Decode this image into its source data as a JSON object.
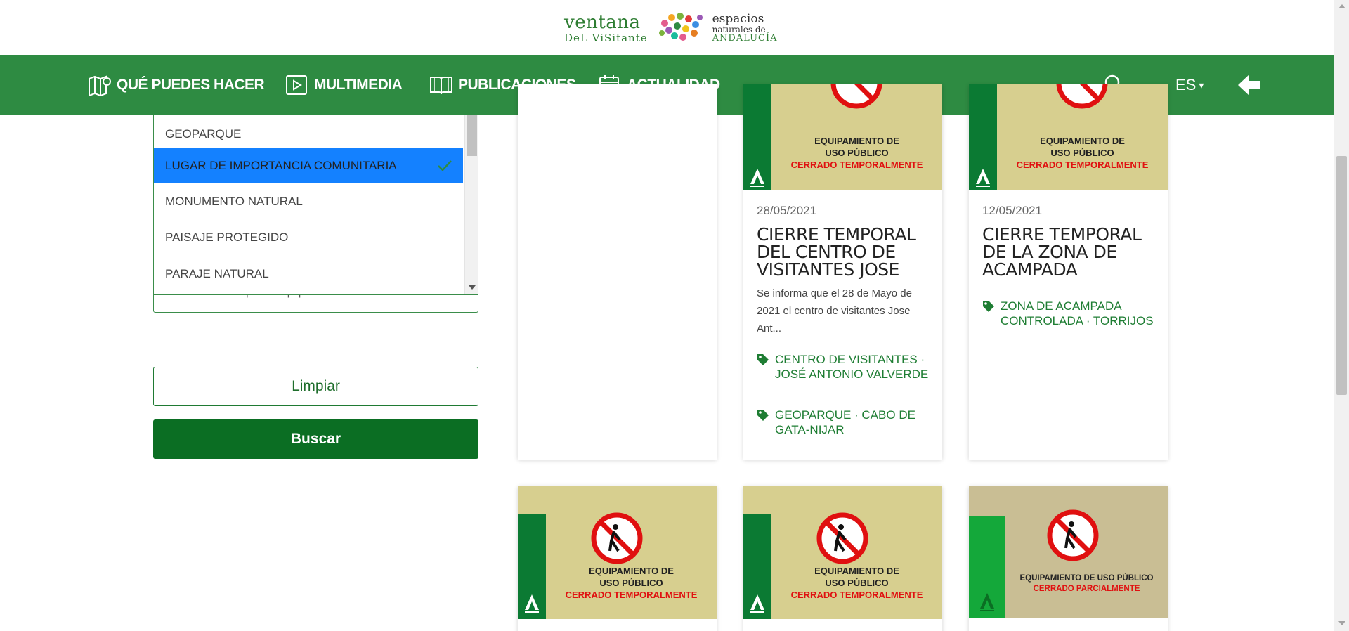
{
  "header": {
    "logo_line1": "ventana",
    "logo_line2": "DeL ViSitante",
    "logo_right1": "espacios",
    "logo_right2": "naturales de",
    "logo_right3": "ANDALUCÍA"
  },
  "nav": {
    "items": [
      {
        "label": "QUÉ PUEDES HACER",
        "icon": "map-icon"
      },
      {
        "label": "MULTIMEDIA",
        "icon": "play-icon"
      },
      {
        "label": "PUBLICACIONES",
        "icon": "book-icon"
      },
      {
        "label": "ACTUALIDAD",
        "icon": "calendar-icon"
      }
    ],
    "language": "ES",
    "language_caret": "▾"
  },
  "colors": {
    "nav_bg": "#2e8b42",
    "brand_green": "#0b6e23",
    "selected_option": "#1481ff",
    "tag_green": "#1e7d33",
    "sign_bg": "#d7cf8f",
    "sign_red": "#e01010"
  },
  "filters": {
    "dropdown_options": [
      "GEOPARQUE",
      "LUGAR DE IMPORTANCIA COMUNITARIA",
      "MONUMENTO NATURAL",
      "PAISAJE PROTEGIDO",
      "PARAJE NATURAL"
    ],
    "selected_option": "LUGAR DE IMPORTANCIA COMUNITARIA",
    "tipo_placeholder": "Seleccione un tipo de equipamiento",
    "clear_label": "Limpiar",
    "search_label": "Buscar"
  },
  "cards": [
    {
      "date": "28/05/2021",
      "title": "CIERRE TEMPORAL DEL CENTRO DE VISITANTES JOSE",
      "description": "Se informa que el 28 de Mayo de 2021 el centro de visitantes Jose Ant...",
      "tags": [
        "CENTRO DE VISITANTES · JOSÉ ANTONIO VALVERDE",
        "GEOPARQUE · CABO DE GATA-NIJAR"
      ],
      "sign_line1": "EQUIPAMIENTO DE",
      "sign_line2": "USO PÚBLICO",
      "sign_line3": "CERRADO TEMPORALMENTE"
    },
    {
      "date": "12/05/2021",
      "title": "CIERRE TEMPORAL DE LA ZONA DE ACAMPADA",
      "tags": [
        "ZONA DE ACAMPADA CONTROLADA · TORRIJOS"
      ],
      "sign_line1": "EQUIPAMIENTO DE",
      "sign_line2": "USO PÚBLICO",
      "sign_line3": "CERRADO TEMPORALMENTE"
    },
    {
      "sign_line1": "EQUIPAMIENTO DE",
      "sign_line2": "USO PÚBLICO",
      "sign_line3": "CERRADO TEMPORALMENTE"
    },
    {
      "sign_line1": "EQUIPAMIENTO DE",
      "sign_line2": "USO PÚBLICO",
      "sign_line3": "CERRADO TEMPORALMENTE"
    },
    {
      "sign_line1": "EQUIPAMIENTO DE USO PÚBLICO",
      "sign_line2": "CERRADO PARCIALMENTE"
    }
  ]
}
